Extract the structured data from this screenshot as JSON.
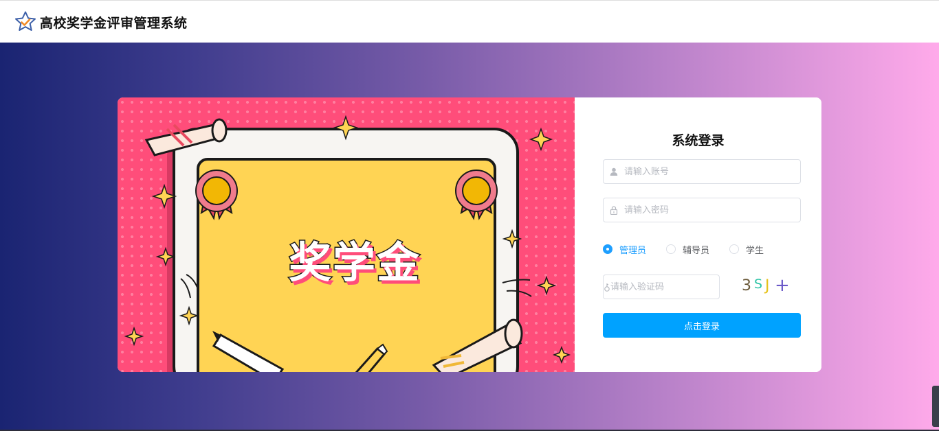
{
  "app": {
    "title": "高校奖学金评审管理系统",
    "logo_icon": "star-check-icon"
  },
  "banner": {
    "text": "奖学金"
  },
  "login": {
    "title": "系统登录",
    "username_placeholder": "请输入账号",
    "password_placeholder": "请输入密码",
    "code_placeholder": "请输入验证码",
    "roles": [
      {
        "label": "管理员",
        "selected": true
      },
      {
        "label": "辅导员",
        "selected": false
      },
      {
        "label": "学生",
        "selected": false
      }
    ],
    "captcha": {
      "chars": [
        {
          "ch": "3",
          "color": "#6b5a3a"
        },
        {
          "ch": "S",
          "color": "#2ec4a6"
        },
        {
          "ch": "J",
          "color": "#e6c21a"
        },
        {
          "ch": "+",
          "color": "#6a58c8"
        }
      ]
    },
    "submit_label": "点击登录"
  },
  "colors": {
    "accent": "#00a2ff",
    "radio_selected": "#1e9fff",
    "banner_pink": "#ff4d7a",
    "banner_yellow": "#ffd454"
  }
}
